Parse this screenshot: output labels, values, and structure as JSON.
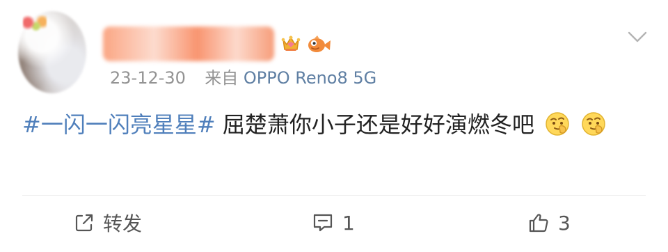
{
  "post": {
    "date": "23-12-30",
    "source_prefix": "来自",
    "source_device": "OPPO Reno8 5G",
    "topic": "#一闪一闪亮星星#",
    "text": " 屈楚萧你小子还是好好演燃冬吧",
    "emoji_name": "thinking-emoji"
  },
  "actions": {
    "repost_label": "转发",
    "comment_count": "1",
    "like_count": "3"
  },
  "colors": {
    "topic": "#4f7fbb",
    "source": "#5f7fa3",
    "meta": "#939393",
    "text": "#222222",
    "name_blur": "#f79a74"
  },
  "icons": {
    "badge_1": "crown-icon",
    "badge_2": "fish-icon",
    "menu": "chevron-down-icon",
    "repost": "share-icon",
    "comment": "comment-icon",
    "like": "thumb-up-icon"
  }
}
